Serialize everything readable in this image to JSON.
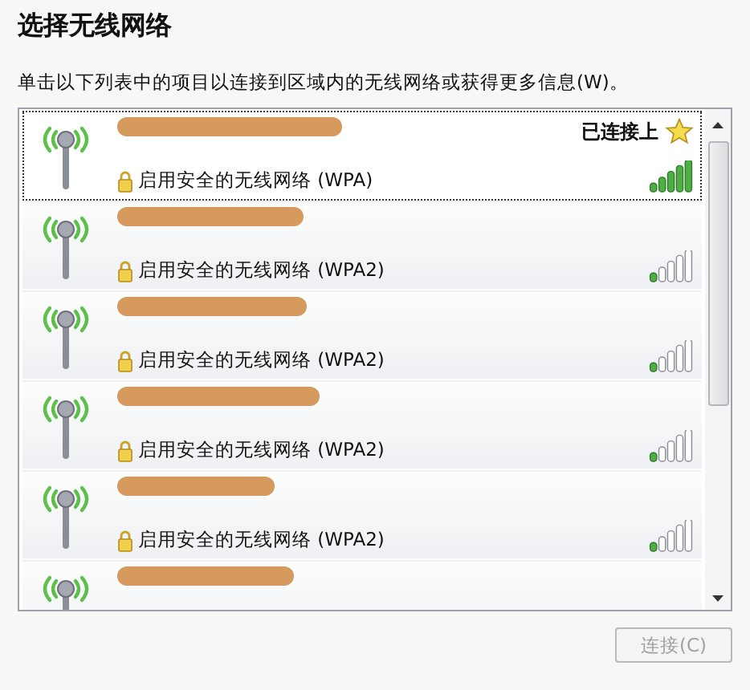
{
  "title": "选择无线网络",
  "description": "单击以下列表中的项目以连接到区域内的无线网络或获得更多信息(W)。",
  "networks": [
    {
      "selected": true,
      "connected": true,
      "status": "已连接上",
      "security": "启用安全的无线网络 (WPA)",
      "level": 1
    },
    {
      "selected": false,
      "connected": false,
      "security": "启用安全的无线网络 (WPA2)",
      "level": 0.2
    },
    {
      "selected": false,
      "connected": false,
      "security": "启用安全的无线网络 (WPA2)",
      "level": 0.2
    },
    {
      "selected": false,
      "connected": false,
      "security": "启用安全的无线网络 (WPA2)",
      "level": 0.2
    },
    {
      "selected": false,
      "connected": false,
      "security": "启用安全的无线网络 (WPA2)",
      "level": 0.2
    },
    {
      "selected": false,
      "connected": false
    }
  ],
  "connect_button": {
    "label": "连接(C)",
    "disabled": true
  }
}
